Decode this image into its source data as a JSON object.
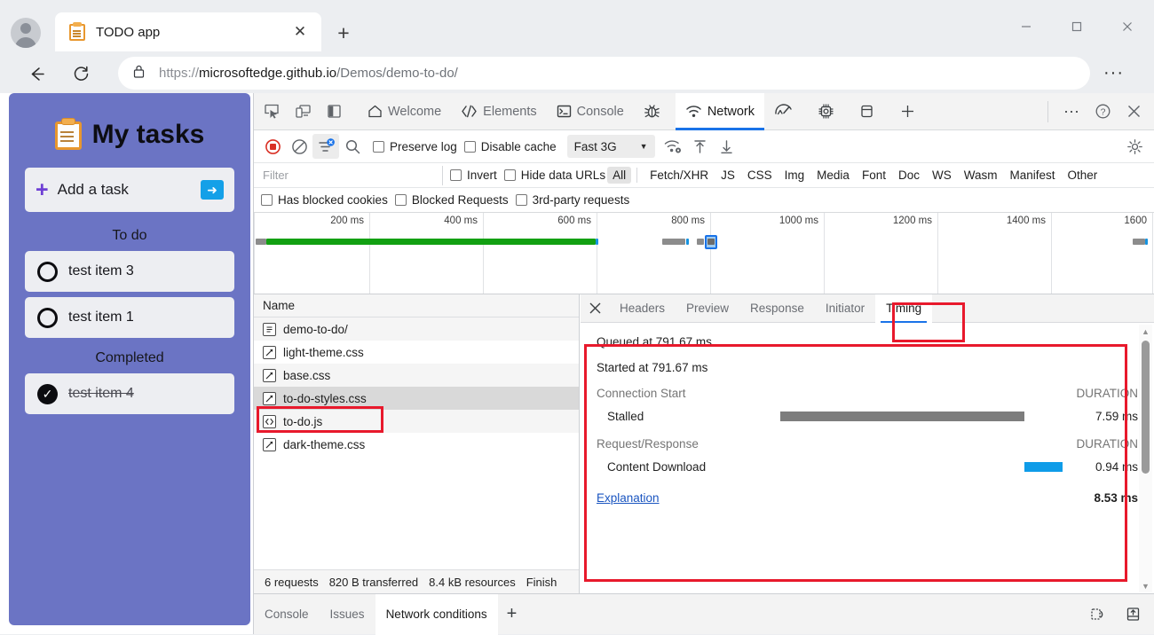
{
  "browser": {
    "tab_title": "TODO app",
    "tab_favicon": "clipboard-icon",
    "close_tab_label": "✕",
    "new_tab_label": "+",
    "back_label": "←",
    "reload_label": "↻",
    "url_scheme": "https://",
    "url_host": "microsoftedge.github.io",
    "url_path": "/Demos/demo-to-do/",
    "more_label": "···",
    "minimize_label": "—",
    "maximize_label": "▢",
    "close_label": "✕"
  },
  "todo_app": {
    "title": "My tasks",
    "add_task_label": "Add a task",
    "add_plus": "+",
    "add_go_label": "➜",
    "sections": [
      {
        "label": "To do",
        "items": [
          {
            "text": "test item 3",
            "done": false
          },
          {
            "text": "test item 1",
            "done": false
          }
        ]
      },
      {
        "label": "Completed",
        "items": [
          {
            "text": "test item 4",
            "done": true
          }
        ]
      }
    ],
    "check_glyph": "✓"
  },
  "devtools": {
    "left_icons": [
      "inspect-element-icon",
      "device-toolbar-icon",
      "dock-side-icon"
    ],
    "tabs": [
      {
        "label": "Welcome",
        "icon": "home-icon",
        "active": false
      },
      {
        "label": "Elements",
        "icon": "code-brackets-icon",
        "active": false
      },
      {
        "label": "Console",
        "icon": "console-prompt-icon",
        "active": false
      },
      {
        "label": "",
        "icon": "bug-icon",
        "active": false
      },
      {
        "label": "Network",
        "icon": "network-wifi-icon",
        "active": true
      },
      {
        "label": "",
        "icon": "performance-gauge-icon",
        "active": false
      },
      {
        "label": "",
        "icon": "memory-chip-icon",
        "active": false
      },
      {
        "label": "",
        "icon": "application-box-icon",
        "active": false
      },
      {
        "label": "",
        "icon": "add-panel-icon",
        "active": false
      }
    ],
    "tab_right_actions": {
      "more_label": "···",
      "help_label": "?",
      "close_label": "✕"
    },
    "toolbar": {
      "record_icon": "record-stop-icon",
      "clear_icon": "clear-network-log-icon",
      "filter_icon": "filter-active-icon",
      "search_icon": "search-icon",
      "preserve_log_label": "Preserve log",
      "disable_cache_label": "Disable cache",
      "throttle_value": "Fast 3G",
      "throttle_caret": "▼",
      "network_conditions_icon": "network-conditions-icon",
      "import_har_icon": "import-har-icon",
      "export_har_icon": "export-har-icon",
      "settings_icon": "gear-icon"
    },
    "filter_row": {
      "filter_placeholder": "Filter",
      "filter_value": "",
      "invert_label": "Invert",
      "hide_data_urls_label": "Hide data URLs",
      "types": [
        "All",
        "Fetch/XHR",
        "JS",
        "CSS",
        "Img",
        "Media",
        "Font",
        "Doc",
        "WS",
        "Wasm",
        "Manifest",
        "Other"
      ],
      "selected_type": "All"
    },
    "blocked_row": {
      "has_blocked_cookies_label": "Has blocked cookies",
      "blocked_requests_label": "Blocked Requests",
      "third_party_requests_label": "3rd-party requests"
    },
    "overview": {
      "ticks": [
        "200 ms",
        "400 ms",
        "600 ms",
        "800 ms",
        "1000 ms",
        "1200 ms",
        "1400 ms",
        "1600"
      ],
      "colors": {
        "doc": "#12a012",
        "idle": "#8c8c8c",
        "accent": "#1693e0",
        "selected_outline": "#1a73e8"
      }
    },
    "request_list": {
      "column_header": "Name",
      "rows": [
        {
          "name": "demo-to-do/",
          "icon": "document-icon",
          "selected": false
        },
        {
          "name": "light-theme.css",
          "icon": "stylesheet-icon",
          "selected": false
        },
        {
          "name": "base.css",
          "icon": "stylesheet-icon",
          "selected": false
        },
        {
          "name": "to-do-styles.css",
          "icon": "stylesheet-icon",
          "selected": true
        },
        {
          "name": "to-do.js",
          "icon": "script-icon",
          "selected": false
        },
        {
          "name": "dark-theme.css",
          "icon": "stylesheet-icon",
          "selected": false
        }
      ],
      "status": [
        "6 requests",
        "820 B transferred",
        "8.4 kB resources",
        "Finish"
      ]
    },
    "detail": {
      "close_label": "✕",
      "tabs": [
        "Headers",
        "Preview",
        "Response",
        "Initiator",
        "Timing"
      ],
      "active_tab": "Timing",
      "timing": {
        "queued_at": "Queued at 791.67 ms",
        "started_at": "Started at 791.67 ms",
        "groups": [
          {
            "name": "Connection Start",
            "duration_header": "DURATION",
            "rows": [
              {
                "label": "Stalled",
                "duration": "7.59 ms",
                "bar_color": "#7d7d7d",
                "bar_left_pct": 34,
                "bar_width_pct": 45
              }
            ]
          },
          {
            "name": "Request/Response",
            "duration_header": "DURATION",
            "rows": [
              {
                "label": "Content Download",
                "duration": "0.94 ms",
                "bar_color": "#0f9ce8",
                "bar_left_pct": 79,
                "bar_width_pct": 7
              }
            ]
          }
        ],
        "explanation_label": "Explanation",
        "total": "8.53 ms"
      }
    },
    "drawer": {
      "tabs": [
        "Console",
        "Issues",
        "Network conditions"
      ],
      "active_tab": "Network conditions",
      "add_label": "+",
      "right_icons": [
        "devices-icon",
        "dock-drawer-icon"
      ]
    },
    "annotation_color": "#e8192c"
  }
}
